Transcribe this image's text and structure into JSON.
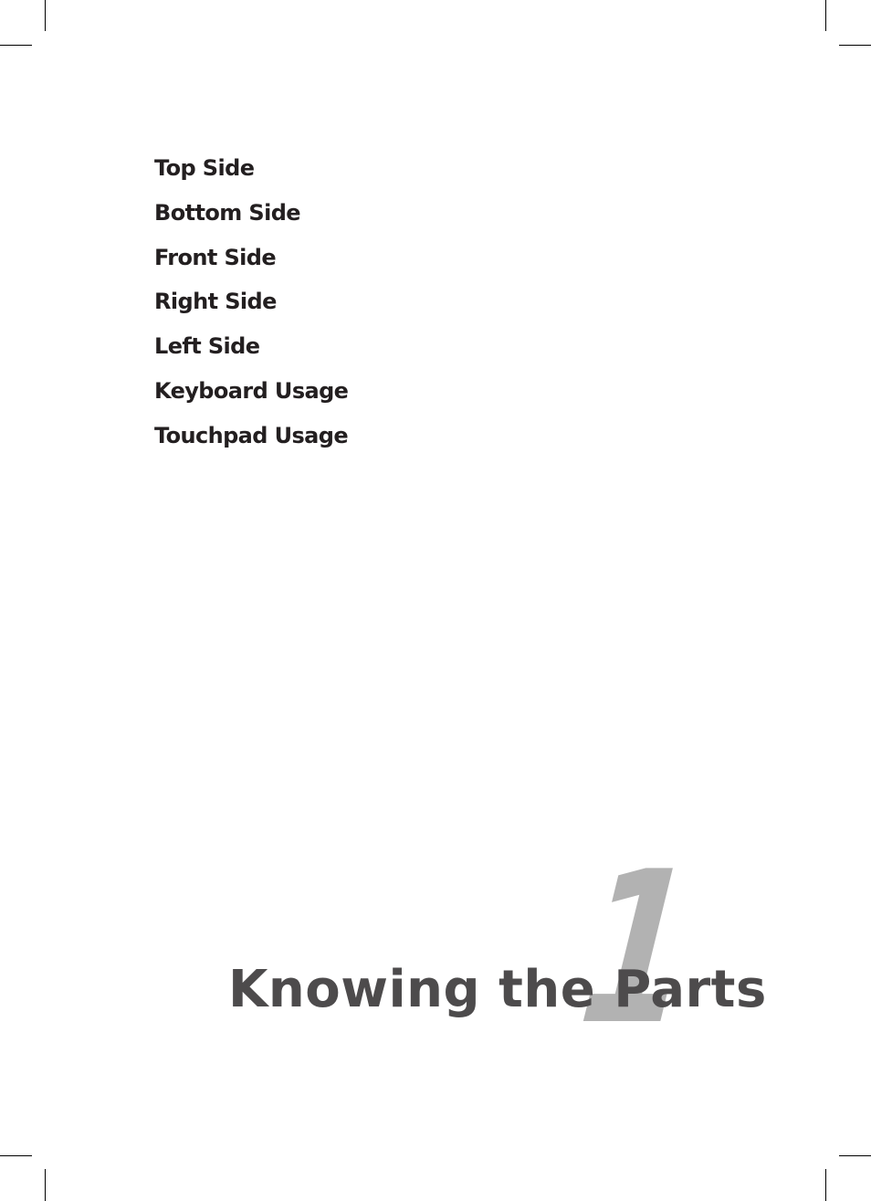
{
  "toc": {
    "items": [
      "Top Side",
      "Bottom Side",
      "Front Side",
      "Right Side",
      "Left Side",
      "Keyboard Usage",
      "Touchpad Usage"
    ]
  },
  "chapter": {
    "number": "1",
    "title": "Knowing the Parts"
  },
  "colors": {
    "toc_text": "#231f20",
    "title_text": "#4d4b4c",
    "chapter_number": "#b2b2b2"
  }
}
